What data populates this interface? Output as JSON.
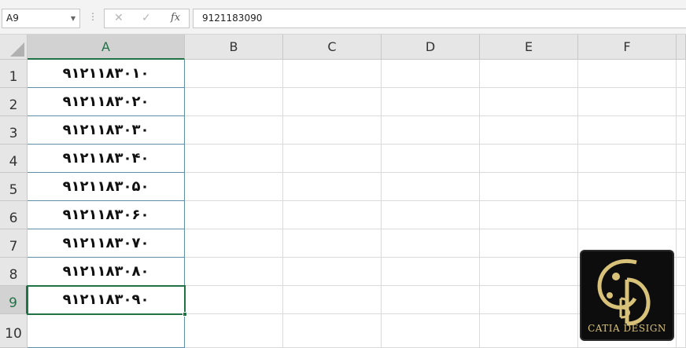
{
  "formula_bar": {
    "name_box": "A9",
    "content": "9121183090",
    "cancel_glyph": "✕",
    "enter_glyph": "✓",
    "fx_label": "fx"
  },
  "columns": [
    "A",
    "B",
    "C",
    "D",
    "E",
    "F"
  ],
  "selected_column": "A",
  "rows": [
    "1",
    "2",
    "3",
    "4",
    "5",
    "6",
    "7",
    "8",
    "9",
    "10"
  ],
  "selected_row": "9",
  "column_a_values": [
    "۹۱۲۱۱۸۳۰۱۰",
    "۹۱۲۱۱۸۳۰۲۰",
    "۹۱۲۱۱۸۳۰۳۰",
    "۹۱۲۱۱۸۳۰۴۰",
    "۹۱۲۱۱۸۳۰۵۰",
    "۹۱۲۱۱۸۳۰۶۰",
    "۹۱۲۱۱۸۳۰۷۰",
    "۹۱۲۱۱۸۳۰۸۰",
    "۹۱۲۱۱۸۳۰۹۰",
    ""
  ],
  "logo": {
    "text": "CATIA DESIGN"
  },
  "colors": {
    "accent": "#217346",
    "header_bg": "#e6e6e6",
    "logo_gold": "#d8c27a"
  }
}
